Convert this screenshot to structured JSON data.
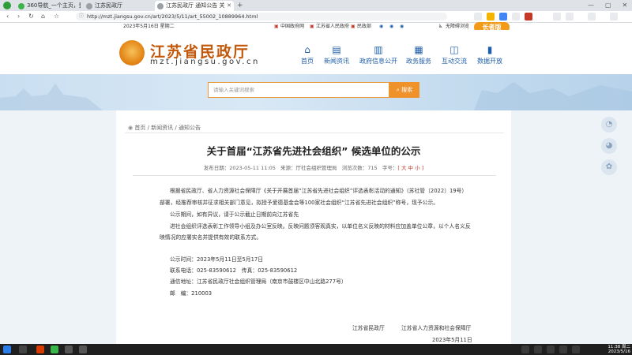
{
  "browser": {
    "tabs": [
      {
        "label": "360导航_一个主页，整个世界",
        "color": "#3bb54a"
      },
      {
        "label": "江苏民政厅",
        "color": "#9aa0a6"
      },
      {
        "label": "江苏民政厅 通知公告 关于首届...",
        "color": "#9aa0a6"
      }
    ],
    "new_tab": "+",
    "url": "http://mzt.jiangsu.gov.cn/art/2023/5/11/art_55002_10889964.html"
  },
  "site_top": {
    "date": "2023年5月16日 星期二",
    "links": [
      "中国政府网",
      "江苏省人民政府",
      "民政部"
    ],
    "tools": [
      "无障碍浏览"
    ],
    "edition": "长者版"
  },
  "header": {
    "title": "江苏省民政厅",
    "domain": "mzt.jiangsu.gov.cn",
    "nav": [
      "首页",
      "新闻资讯",
      "政府信息公开",
      "政务服务",
      "互动交流",
      "数据开放"
    ]
  },
  "search": {
    "placeholder": "请输入关键词搜索",
    "button": "搜索"
  },
  "breadcrumb": [
    "首页",
    "新闻资讯",
    "通知公告"
  ],
  "article": {
    "title": "关于首届“江苏省先进社会组织” 候选单位的公示",
    "meta": {
      "date": "发布日期：2023-05-11 11:05",
      "source": "来源：厅社会组织管理局",
      "views": "浏览次数：",
      "views_count": "715",
      "fontsize": "字号：",
      "fontsize_opts": "[ 大 中 小 ]"
    },
    "p1a": "根据省民政厅、省人力资源社会保障厅《关于开展首届“江苏省先进社会组织”评选表彰活动的通知》（苏社管〔2022〕19号）",
    "p1b": "部署，经推荐审核并征求相关部门意见，拟授予爱德基金会等100家社会组织“江苏省先进社会组织”称号，现予公示。",
    "p2": "公示期间，如有异议，请于公示截止日期前向江苏省先",
    "p3a": "进社会组织评选表彰工作领导小组及办公室反映。反映问题须客观真实，以单位名义反映的材料应加盖单位公章，以个人名义反",
    "p3b": "映情况的应署实名并提供有效的联系方式。",
    "contact": {
      "period": "公示时间：2023年5月11日至5月17日",
      "phone": "联系电话：025-83590612　传真：025-83590612",
      "address": "通信地址：江苏省民政厅社会组织管理局（南京市鼓楼区中山北路277号）",
      "zip": "邮　编：210003"
    },
    "sign1": "江苏省民政厅",
    "sign2": "江苏省人力资源和社会保障厅",
    "sign_date": "2023年5月11日"
  },
  "taskbar": {
    "time": "11:38 周二",
    "date": "2023/5/16"
  },
  "colors": {
    "brand_orange": "#f0922a",
    "nav_blue": "#1f5ea8",
    "logo_text": "#c4580a"
  }
}
